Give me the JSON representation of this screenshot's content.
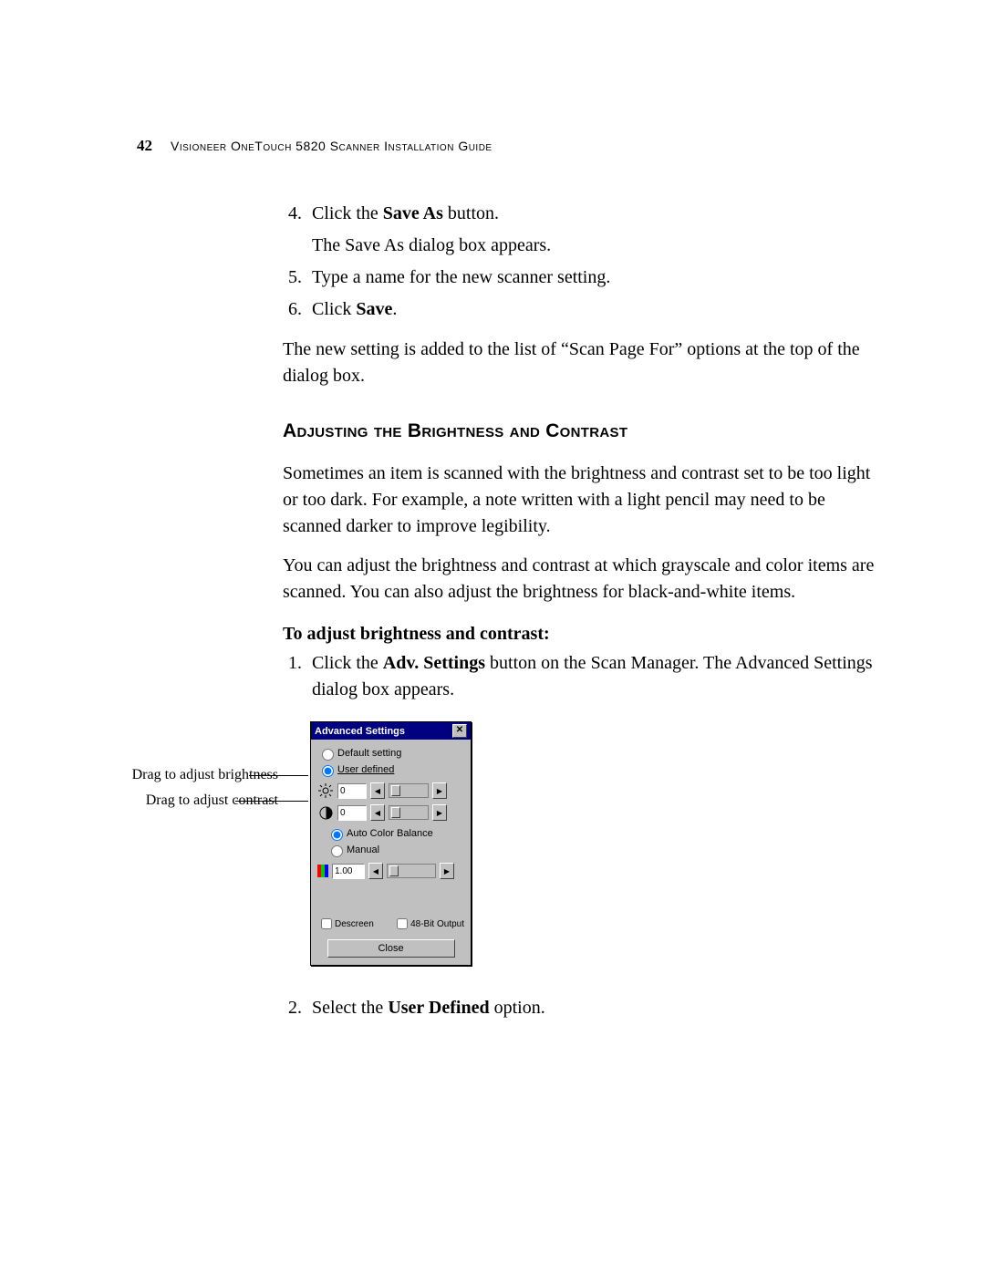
{
  "header": {
    "page_number": "42",
    "running_head": "Visioneer OneTouch 5820 Scanner Installation Guide"
  },
  "steps_first": [
    {
      "n": "4",
      "pre": "Click the ",
      "bold": "Save As",
      "post": " button."
    },
    {
      "n": "",
      "plain": "The Save As dialog box appears."
    },
    {
      "n": "5",
      "plain": "Type a name for the new scanner setting."
    },
    {
      "n": "6",
      "pre": "Click ",
      "bold": "Save",
      "post": "."
    }
  ],
  "para_after_steps": "The new setting is added to the list of “Scan Page For” options at the top of the dialog box.",
  "heading": "Adjusting the Brightness and Contrast",
  "para1": "Sometimes an item is scanned with the brightness and contrast set to be too light or too dark. For example, a note written with a light pencil may need to be scanned darker to improve legibility.",
  "para2": "You can adjust the brightness and contrast at which grayscale and color items are scanned. You can also adjust the brightness for black-and-white items.",
  "subhead": "To adjust brightness and contrast:",
  "step1": {
    "pre": "Click the ",
    "bold": "Adv. Settings",
    "post": " button on the Scan Manager. The Advanced Settings dialog box appears."
  },
  "callout_brightness": "Drag to adjust brightness",
  "callout_contrast": "Drag to adjust contrast",
  "dialog": {
    "title": "Advanced Settings",
    "radio_default": "Default setting",
    "radio_user": "User defined",
    "brightness_value": "0",
    "contrast_value": "0",
    "radio_auto_color": "Auto Color Balance",
    "radio_manual": "Manual",
    "gamma_value": "1.00",
    "check_descreen": "Descreen",
    "check_48bit": "48-Bit Output",
    "close_label": "Close"
  },
  "step2": {
    "pre": "Select the ",
    "bold": "User Defined",
    "post": " option."
  }
}
